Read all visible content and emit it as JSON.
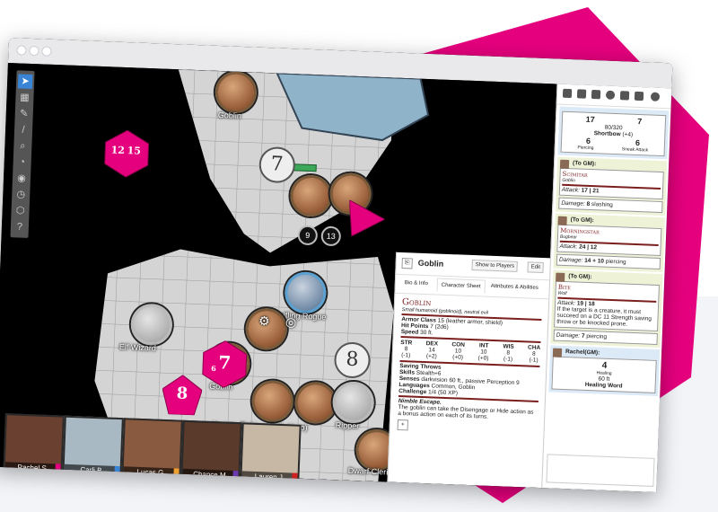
{
  "brand_colors": {
    "magenta": "#e5007d",
    "window_chrome": "#e9e9ec",
    "accent_blue": "#3a84d6",
    "dnd_red": "#7a1e1e"
  },
  "toolbar_icons": [
    "cursor-icon",
    "map-icon",
    "draw-icon",
    "pen-icon",
    "zoom-icon",
    "ruler-icon",
    "eye-icon",
    "clock-icon",
    "dice-icon",
    "help-icon"
  ],
  "map": {
    "tokens": [
      {
        "label": "Goblin",
        "name": "goblin-top"
      },
      {
        "label": "Halfling Rogue",
        "name": "halfling-rogue"
      },
      {
        "label": "Elf Wizard",
        "name": "elf-wizard"
      },
      {
        "label": "Goblin",
        "name": "goblin-bottom"
      },
      {
        "label": "Human Fighter (Folk Hero)",
        "name": "human-fighter"
      },
      {
        "label": "Ripper",
        "name": "ripper"
      },
      {
        "label": "Dwarf Cleric",
        "name": "dwarf-cleric"
      }
    ],
    "big_numbers": [
      "7",
      "8"
    ],
    "badges": [
      "9",
      "13"
    ],
    "dice": [
      "12",
      "15",
      "7",
      "8",
      "6"
    ]
  },
  "videos": [
    {
      "name": "Rachel S.",
      "tag": "#e5007d"
    },
    {
      "name": "Carli B.",
      "tag": "#3a84d6"
    },
    {
      "name": "Lucas G.",
      "tag": "#f0a030"
    },
    {
      "name": "Chance M.",
      "tag": "#6a3ab0"
    },
    {
      "name": "Lauren J.",
      "tag": "#d02020"
    }
  ],
  "sheet": {
    "title": "Goblin",
    "show_button": "Show to Players",
    "edit_button": "Edit",
    "tabs": [
      "Bio & Info",
      "Character Sheet",
      "Attributes & Abilities"
    ],
    "monster_name": "Goblin",
    "subtitle": "Small humanoid (goblinoid), neutral evil",
    "armor_class_label": "Armor Class",
    "armor_class": "15 (leather armor, shield)",
    "hit_points_label": "Hit Points",
    "hit_points": "7 (2d6)",
    "speed_label": "Speed",
    "speed": "30 ft.",
    "abilities": [
      {
        "k": "STR",
        "v": "8",
        "m": "(-1)"
      },
      {
        "k": "DEX",
        "v": "14",
        "m": "(+2)"
      },
      {
        "k": "CON",
        "v": "10",
        "m": "(+0)"
      },
      {
        "k": "INT",
        "v": "10",
        "m": "(+0)"
      },
      {
        "k": "WIS",
        "v": "8",
        "m": "(-1)"
      },
      {
        "k": "CHA",
        "v": "8",
        "m": "(-1)"
      }
    ],
    "saving_throws_label": "Saving Throws",
    "skills_label": "Skills",
    "skills": "Stealth+6",
    "senses_label": "Senses",
    "senses": "darkvision 60 ft., passive Perception 9",
    "languages_label": "Languages",
    "languages": "Common, Goblin",
    "challenge_label": "Challenge",
    "challenge": "1/4 (50 XP)",
    "trait_title": "Nimble Escape.",
    "trait_text": "The goblin can take the Disengage or Hide action as a bonus action on each of its turns."
  },
  "chat": {
    "top_card": {
      "a": "17",
      "b": "7",
      "c": "80/320",
      "weapon": "Shortbow",
      "weapon_mod": "(+4)",
      "d": "6",
      "e": "6",
      "d_label": "Piercing",
      "e_label": "Sneak Attack"
    },
    "messages": [
      {
        "who": "(To GM):",
        "weapon": "Scimitar",
        "owner": "Goblin",
        "attack_label": "Attack:",
        "attack": "17 | 21",
        "damage_label": "Damage:",
        "damage": "8",
        "damage_type": "slashing"
      },
      {
        "who": "(To GM):",
        "weapon": "Morningstar",
        "owner": "Bugbear",
        "attack_label": "Attack:",
        "attack": "24 | 12",
        "damage_label": "Damage:",
        "damage": "14 + 10",
        "damage_type": "piercing"
      },
      {
        "who": "(To GM):",
        "weapon": "Bite",
        "owner": "Wolf",
        "attack_label": "Attack:",
        "attack": "19 | 18",
        "effect": "If the target is a creature, it must succeed on a DC 11 Strength saving throw or be knocked prone.",
        "damage_label": "Damage:",
        "damage": "7",
        "damage_type": "piercing"
      }
    ],
    "heal": {
      "who": "Rachel(GM):",
      "value": "4",
      "sub": "Healing",
      "range": "60 ft",
      "spell": "Healing Word"
    }
  }
}
